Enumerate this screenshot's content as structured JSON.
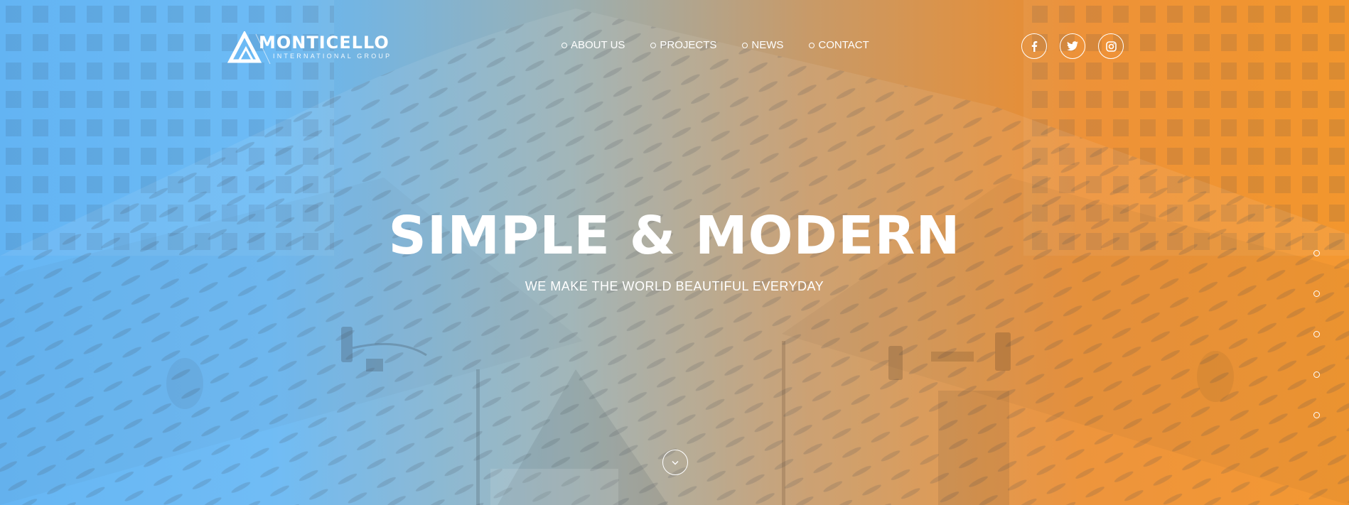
{
  "brand": {
    "name": "MONTICELLO",
    "tagline": "INTERNATIONAL GROUP",
    "logo_icon": "triangle-logo-icon"
  },
  "nav": {
    "items": [
      {
        "label": "ABOUT US",
        "icon": "circle-bullet-icon"
      },
      {
        "label": "PROJECTS",
        "icon": "circle-bullet-icon"
      },
      {
        "label": "NEWS",
        "icon": "circle-bullet-icon"
      },
      {
        "label": "CONTACT",
        "icon": "circle-bullet-icon"
      }
    ]
  },
  "social": [
    {
      "name": "facebook",
      "icon": "facebook-icon"
    },
    {
      "name": "twitter",
      "icon": "twitter-icon"
    },
    {
      "name": "instagram",
      "icon": "instagram-icon"
    }
  ],
  "hero": {
    "title": "SIMPLE & MODERN",
    "subtitle": "WE MAKE THE WORLD BEAUTIFUL EVERYDAY",
    "scroll_icon": "chevron-down-icon"
  },
  "slide_dots": {
    "count": 5
  },
  "colors": {
    "gradient_left": "#5ab0f3",
    "gradient_right": "#f39020",
    "text": "#ffffff"
  }
}
